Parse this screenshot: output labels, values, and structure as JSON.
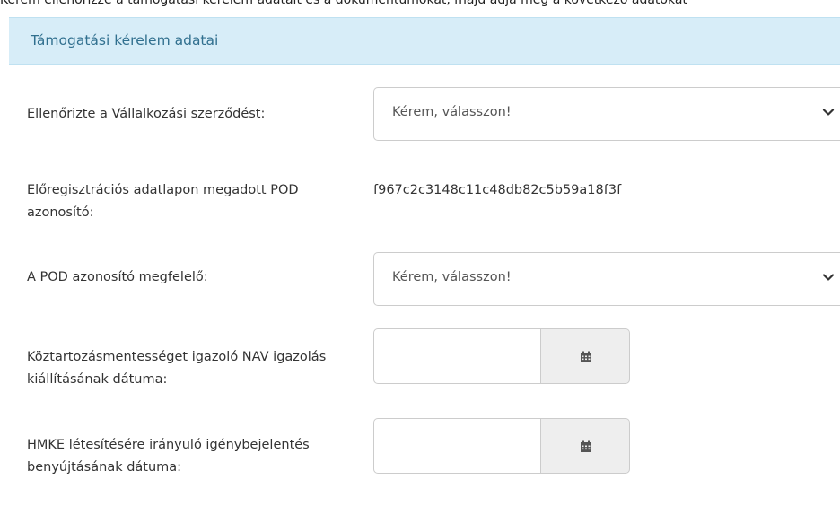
{
  "top_cut_text": "Kérem ellenőrizze a támogatási kérelem adatait és a dokumentumokat, majd adja meg a következő adatokat",
  "panel": {
    "title": "Támogatási kérelem adatai"
  },
  "fields": {
    "contract_checked": {
      "label": "Ellenőrizte a Vállalkozási szerződést:",
      "value": "Kérem, válasszon!"
    },
    "pod_id": {
      "label": "Előregisztrációs adatlapon megadott POD azonosító:",
      "value": "f967c2c3148c11c48db82c5b59a18f3f"
    },
    "pod_ok": {
      "label": "A POD azonosító megfelelő:",
      "value": "Kérem, válasszon!"
    },
    "nav_date": {
      "label": "Köztartozásmentességet igazoló NAV igazolás kiállításának dátuma:",
      "value": ""
    },
    "hmke_date": {
      "label": "HMKE létesítésére irányuló igénybejelentés benyújtásának dátuma:",
      "value": ""
    }
  },
  "icons": {
    "select_arrow": "chevron-down-icon",
    "date_button": "calendar-icon"
  },
  "colors": {
    "panel_bg": "#d7edf8",
    "panel_title": "#31708f",
    "input_border": "#cccccc",
    "addon_bg": "#eeeeee"
  }
}
